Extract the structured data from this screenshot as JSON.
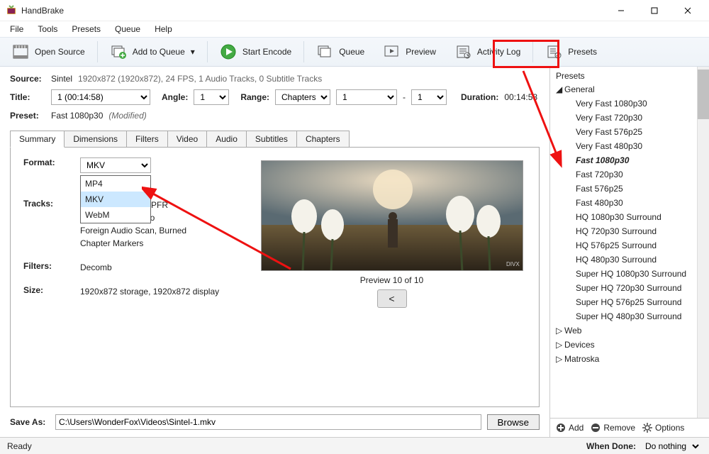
{
  "app_title": "HandBrake",
  "menu": [
    "File",
    "Tools",
    "Presets",
    "Queue",
    "Help"
  ],
  "toolbar": {
    "open_source": "Open Source",
    "add_queue": "Add to Queue",
    "start_encode": "Start Encode",
    "queue": "Queue",
    "preview": "Preview",
    "activity": "Activity Log",
    "presets": "Presets"
  },
  "source": {
    "label": "Source:",
    "name": "Sintel",
    "info": "1920x872 (1920x872), 24 FPS, 1 Audio Tracks, 0 Subtitle Tracks"
  },
  "title_row": {
    "label": "Title:",
    "value": "1  (00:14:58)",
    "angle_label": "Angle:",
    "angle_value": "1",
    "range_label": "Range:",
    "range_type": "Chapters",
    "range_from": "1",
    "range_sep": "-",
    "range_to": "1",
    "duration_label": "Duration:",
    "duration_value": "00:14:58"
  },
  "preset_row": {
    "label": "Preset:",
    "value": "Fast 1080p30",
    "modified": "(Modified)"
  },
  "tabs": [
    "Summary",
    "Dimensions",
    "Filters",
    "Video",
    "Audio",
    "Subtitles",
    "Chapters"
  ],
  "summary": {
    "format_label": "Format:",
    "format_value": "MKV",
    "format_options": [
      "MP4",
      "MKV",
      "WebM"
    ],
    "tracks_label": "Tracks:",
    "tracks_lines": [
      "PFR",
      "eo",
      "Foreign Audio Scan, Burned",
      "Chapter Markers"
    ],
    "filters_label": "Filters:",
    "filters_value": "Decomb",
    "size_label": "Size:",
    "size_value": "1920x872 storage, 1920x872 display"
  },
  "preview": {
    "caption": "Preview 10 of 10",
    "btn": "<"
  },
  "save": {
    "label": "Save As:",
    "path": "C:\\Users\\WonderFox\\Videos\\Sintel-1.mkv",
    "browse": "Browse"
  },
  "presets_panel": {
    "header": "Presets",
    "groups": [
      {
        "name": "General",
        "expanded": true,
        "items": [
          "Very Fast 1080p30",
          "Very Fast 720p30",
          "Very Fast 576p25",
          "Very Fast 480p30",
          "Fast 1080p30",
          "Fast 720p30",
          "Fast 576p25",
          "Fast 480p30",
          "HQ 1080p30 Surround",
          "HQ 720p30 Surround",
          "HQ 576p25 Surround",
          "HQ 480p30 Surround",
          "Super HQ 1080p30 Surround",
          "Super HQ 720p30 Surround",
          "Super HQ 576p25 Surround",
          "Super HQ 480p30 Surround"
        ]
      },
      {
        "name": "Web",
        "expanded": false
      },
      {
        "name": "Devices",
        "expanded": false
      },
      {
        "name": "Matroska",
        "expanded": false
      }
    ],
    "selected": "Fast 1080p30",
    "foot": {
      "add": "Add",
      "remove": "Remove",
      "options": "Options"
    }
  },
  "status": {
    "ready": "Ready",
    "when_done_label": "When Done:",
    "when_done_value": "Do nothing"
  }
}
